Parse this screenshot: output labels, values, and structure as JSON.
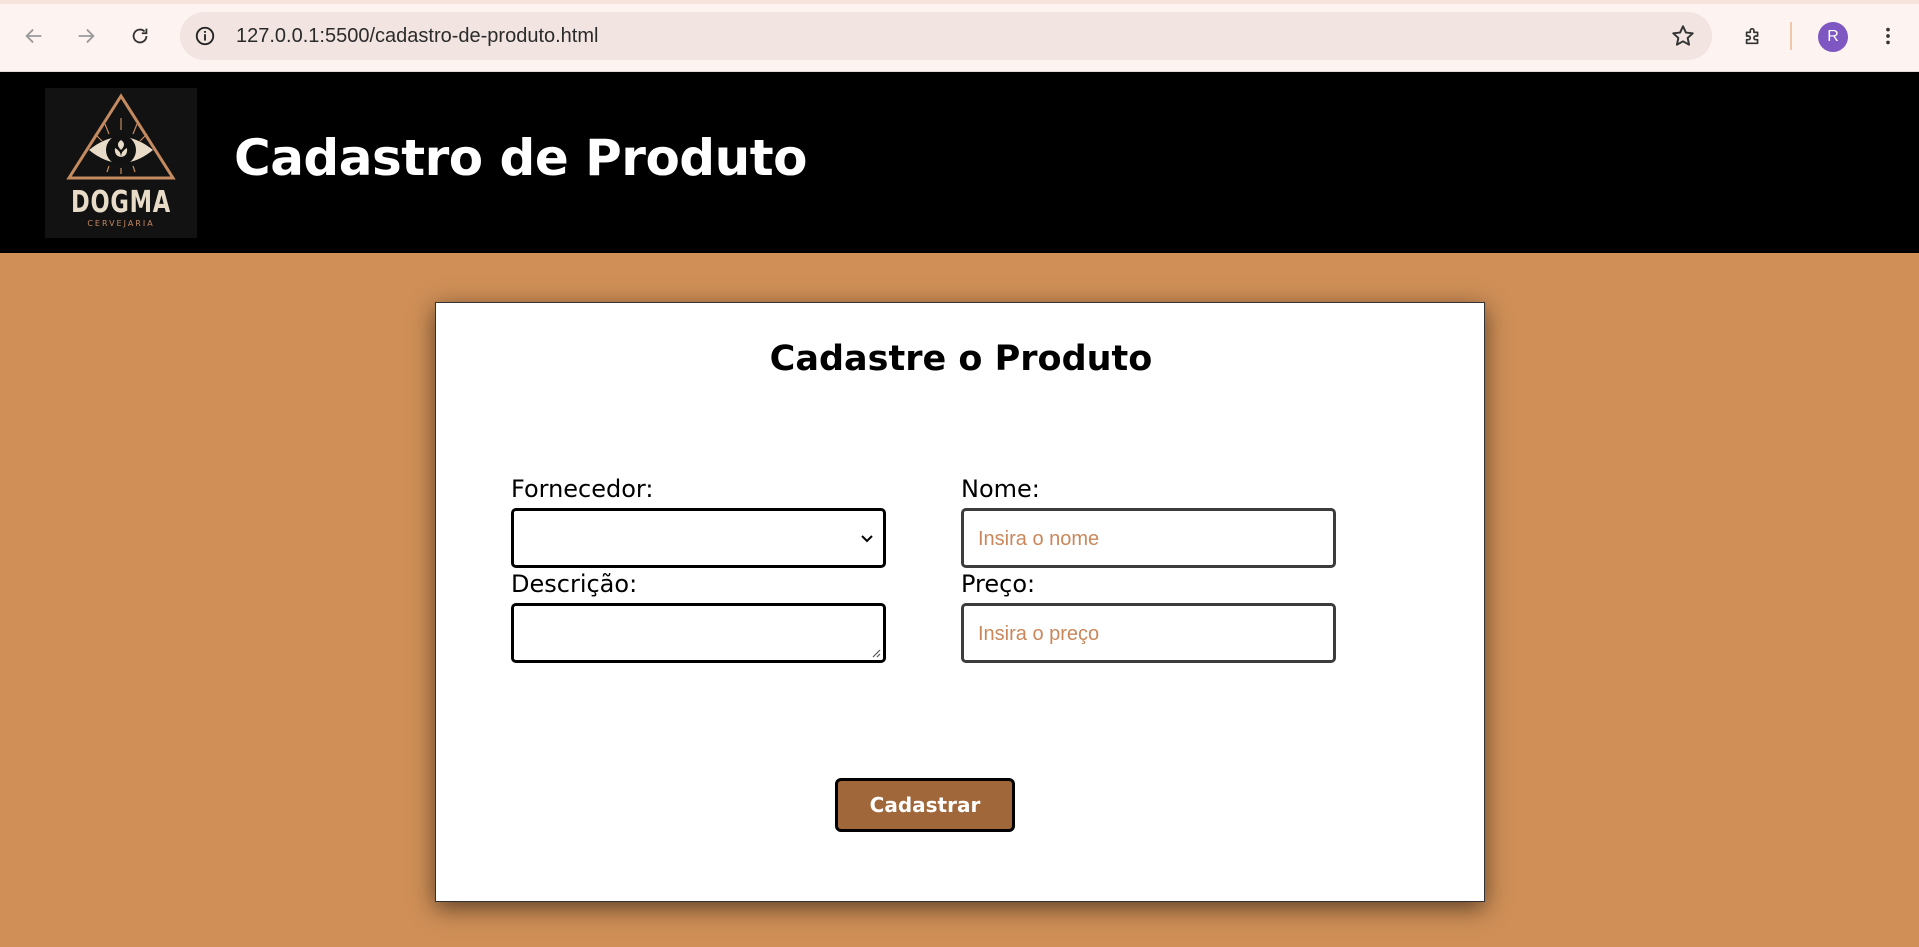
{
  "browser": {
    "url": "127.0.0.1:5500/cadastro-de-produto.html",
    "profile_initial": "R",
    "icons": [
      "back-arrow-icon",
      "forward-arrow-icon",
      "reload-icon",
      "info-icon",
      "star-icon",
      "extensions-icon",
      "kebab-menu-icon"
    ]
  },
  "header": {
    "title": "Cadastro de Produto",
    "logo": {
      "brand": "DOGMA",
      "sub": "CERVEJARIA"
    }
  },
  "form": {
    "heading": "Cadastre o Produto",
    "fornecedor_label": "Fornecedor:",
    "fornecedor_value": "",
    "nome_label": "Nome:",
    "nome_placeholder": "Insira o nome",
    "descricao_label": "Descrição:",
    "descricao_value": "",
    "preco_label": "Preço:",
    "preco_placeholder": "Insira o preço",
    "submit_label": "Cadastrar"
  },
  "colors": {
    "page_bg": "#cf8f57",
    "header_bg": "#000000",
    "button_bg": "#a0673a",
    "placeholder": "#c9875a"
  }
}
